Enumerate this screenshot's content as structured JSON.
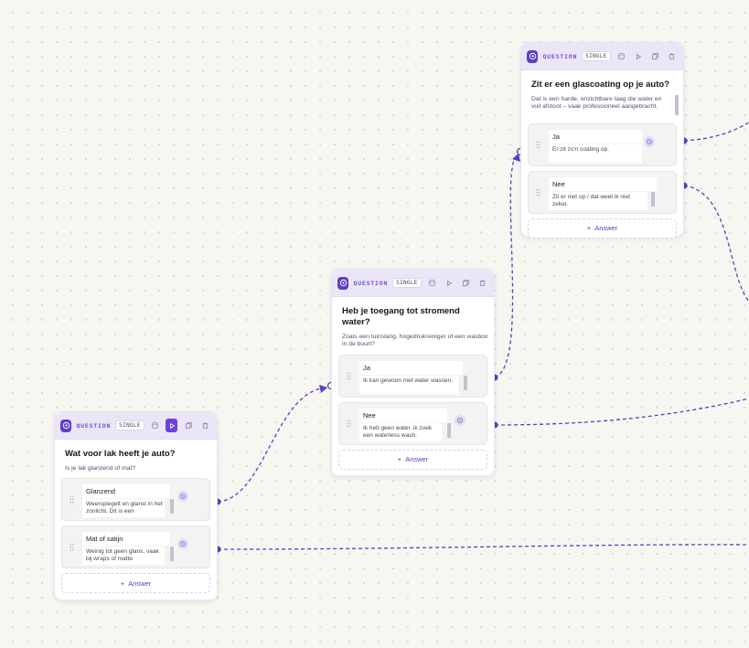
{
  "canvas": {
    "accent": "#5b3fc4",
    "edge_color": "#5a3fc0",
    "background": "#f8f6f1"
  },
  "nodes": [
    {
      "type_label": "QUESTION",
      "badge": "SINGLE",
      "title": "Wat voor lak heeft je auto?",
      "description": "Is je lak glanzend of mat?",
      "answers": [
        {
          "label": "Glanzend",
          "description": "Weerspiegelt en glanst in het zonlicht. Dit is een"
        },
        {
          "label": "Mat of satijn",
          "description": "Weinig tot geen glans, vaak bij wraps of matte"
        }
      ],
      "add_answer": "Answer"
    },
    {
      "type_label": "QUESTION",
      "badge": "SINGLE",
      "title": "Heb je toegang tot stromend water?",
      "description": "Zoals een tuinslang, hogedrukreiniger of een wasbox in de buurt?",
      "answers": [
        {
          "label": "Ja",
          "description": "Ik kan gewoon met water wassen."
        },
        {
          "label": "Nee",
          "description": "Ik heb geen water, ik zoek een waterless wash."
        }
      ],
      "add_answer": "Answer"
    },
    {
      "type_label": "QUESTION",
      "badge": "SINGLE",
      "title": "Zit er een glascoating op je auto?",
      "description": "Dat is een harde, onzichtbare laag die water en vuil afstoot – vaak professioneel aangebracht.",
      "answers": [
        {
          "label": "Ja",
          "description": "Er zit zo'n coating op."
        },
        {
          "label": "Nee",
          "description": "Zit er niet op / dat weet ik niet zeker."
        }
      ],
      "add_answer": "Answer"
    }
  ],
  "icons": {
    "node": "question-icon",
    "header_buttons": [
      "palette-icon",
      "play-icon",
      "duplicate-icon",
      "trash-icon"
    ],
    "answer_link": "goto-icon",
    "drag": "drag-handle-icon"
  }
}
